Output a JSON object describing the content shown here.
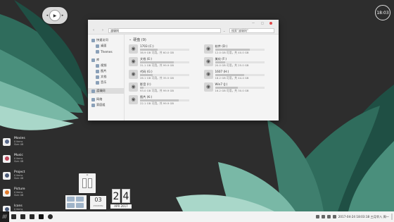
{
  "media_widget": {
    "prev_icon": "skip-back-icon",
    "play_icon": "play-icon",
    "next_icon": "skip-forward-icon"
  },
  "clock": {
    "time": "18:03"
  },
  "window": {
    "title_controls": [
      "—",
      "□",
      "×"
    ],
    "address": "渡壕网",
    "search_placeholder": "搜索\"渡壕网\"",
    "sidebar": [
      {
        "label": "快速访问",
        "sub": false
      },
      {
        "label": "桌面",
        "sub": true
      },
      {
        "label": "Themes",
        "sub": true
      },
      {
        "label": "库",
        "sub": false
      },
      {
        "label": "视频",
        "sub": true
      },
      {
        "label": "图片",
        "sub": true
      },
      {
        "label": "文档",
        "sub": true
      },
      {
        "label": "音乐",
        "sub": true
      },
      {
        "label": "渡壕网",
        "sub": false,
        "selected": true
      },
      {
        "label": "网络",
        "sub": false
      },
      {
        "label": "家庭组",
        "sub": false
      }
    ],
    "section_title": "硬盘 (9)",
    "drives": [
      {
        "name": "1703 (C:)",
        "size": "38.9 GB 可用，共 60.0 GB",
        "used": 0.35
      },
      {
        "name": "软件 (D:)",
        "size": "12.0 GB 可用，共 40.0 GB",
        "used": 0.7
      },
      {
        "name": "文档 (E:)",
        "size": "31.1 GB 可用，共 99.9 GB",
        "used": 0.69
      },
      {
        "name": "美化 (F:)",
        "size": "20.0 GB 可用，共 25.0 GB",
        "used": 0.2
      },
      {
        "name": "代码 (G:)",
        "size": "26.1 GB 可用，共 35.5 GB",
        "used": 0.26
      },
      {
        "name": "1607 (H:)",
        "size": "18.2 GB 可用，共 44.4 GB",
        "used": 0.59
      },
      {
        "name": "影音 (I:)",
        "size": "93.0 GB 可用，共 99.9 GB",
        "used": 0.07
      },
      {
        "name": "Win7 (J:)",
        "size": "16.2 GB 可用，共 30.0 GB",
        "used": 0.46
      },
      {
        "name": "图片 (K:)",
        "size": "22.1 GB 可用，共 99.9 GB",
        "used": 0.78
      }
    ]
  },
  "dock": [
    {
      "title": "Movies",
      "line1": "0 items",
      "line2": "Size: 0B",
      "color": "#5b6b8c"
    },
    {
      "title": "Music",
      "line1": "0 items",
      "line2": "Size: 0B",
      "color": "#c0485b"
    },
    {
      "title": "Project",
      "line1": "0 items",
      "line2": "Size: 0B",
      "color": "#4a5a78"
    },
    {
      "title": "Picture",
      "line1": "0 items",
      "line2": "Size: 0B",
      "color": "#e07a2c"
    },
    {
      "title": "Icons",
      "line1": "0 items",
      "line2": "Size: 0B",
      "color": "#4a5a78"
    }
  ],
  "widgets": {
    "num_value": "03",
    "num_label": "2566MHz",
    "cal_day": [
      "2",
      "4"
    ],
    "cal_month": "APR 2017"
  },
  "taskbar": {
    "start_glyph": "///",
    "datetime": "2017-04-24 18:03:18 三月廿八 周一"
  }
}
